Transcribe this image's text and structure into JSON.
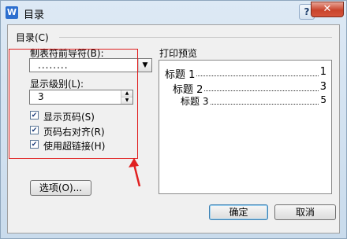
{
  "window": {
    "title": "目录",
    "app_icon_glyph": "W",
    "help_label": "?",
    "close_label": "✕"
  },
  "group": {
    "legend": "目录(C)"
  },
  "leader": {
    "label": "制表符前导符(B):",
    "value": "........"
  },
  "level": {
    "label": "显示级别(L):",
    "value": "3"
  },
  "checkboxes": [
    {
      "label": "显示页码(S)",
      "checked": true
    },
    {
      "label": "页码右对齐(R)",
      "checked": true
    },
    {
      "label": "使用超链接(H)",
      "checked": true
    }
  ],
  "preview": {
    "label": "打印预览",
    "entries": [
      {
        "title": "标题 1",
        "page": "1"
      },
      {
        "title": "标题 2",
        "page": "3"
      },
      {
        "title": "标题 3",
        "page": "5"
      }
    ]
  },
  "buttons": {
    "options": "选项(O)...",
    "ok": "确定",
    "cancel": "取消"
  },
  "colors": {
    "annotation": "#e02020",
    "close": "#c9442c"
  }
}
